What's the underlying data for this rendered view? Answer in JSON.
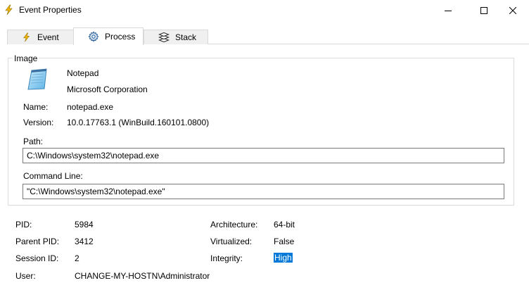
{
  "window": {
    "title": "Event Properties"
  },
  "tabs": [
    {
      "label": "Event"
    },
    {
      "label": "Process"
    },
    {
      "label": "Stack"
    }
  ],
  "image_group": {
    "label": "Image",
    "product_name": "Notepad",
    "company": "Microsoft Corporation",
    "name_label": "Name:",
    "name_value": "notepad.exe",
    "version_label": "Version:",
    "version_value": "10.0.17763.1 (WinBuild.160101.0800)",
    "path_label": "Path:",
    "path_value": "C:\\Windows\\system32\\notepad.exe",
    "cmdline_label": "Command Line:",
    "cmdline_value": "\"C:\\Windows\\system32\\notepad.exe\""
  },
  "details": {
    "pid_label": "PID:",
    "pid_value": "5984",
    "ppid_label": "Parent PID:",
    "ppid_value": "3412",
    "session_label": "Session ID:",
    "session_value": "2",
    "user_label": "User:",
    "user_value": "CHANGE-MY-HOSTN\\Administrator",
    "arch_label": "Architecture:",
    "arch_value": "64-bit",
    "virt_label": "Virtualized:",
    "virt_value": "False",
    "integrity_label": "Integrity:",
    "integrity_value": "High"
  },
  "colors": {
    "accent": "#0078d7",
    "lightning": "#f2b600"
  }
}
